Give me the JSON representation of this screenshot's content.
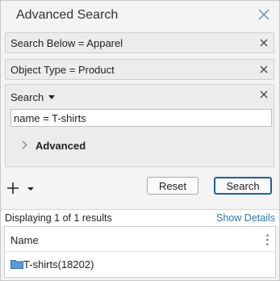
{
  "panel": {
    "title": "Advanced Search",
    "close_icon": "close-icon"
  },
  "chips": [
    {
      "label": "Search Below = Apparel",
      "remove_icon": "close-icon"
    },
    {
      "label": "Object Type = Product",
      "remove_icon": "close-icon"
    }
  ],
  "search": {
    "dropdown_label": "Search",
    "query_value": "name = T-shirts",
    "advanced_label": "Advanced"
  },
  "toolbar": {
    "add_icon": "plus-icon",
    "reset_label": "Reset",
    "search_label": "Search"
  },
  "results": {
    "display_text": "Displaying 1 of 1 results",
    "show_details_label": "Show Details",
    "column_header": "Name",
    "rows": [
      {
        "label": "T-shirts",
        "count": "(18202)",
        "icon": "folder-icon"
      }
    ]
  },
  "colors": {
    "accent": "#1f5ea8",
    "link": "#2a7bb8",
    "folder": "#4a90d9"
  }
}
